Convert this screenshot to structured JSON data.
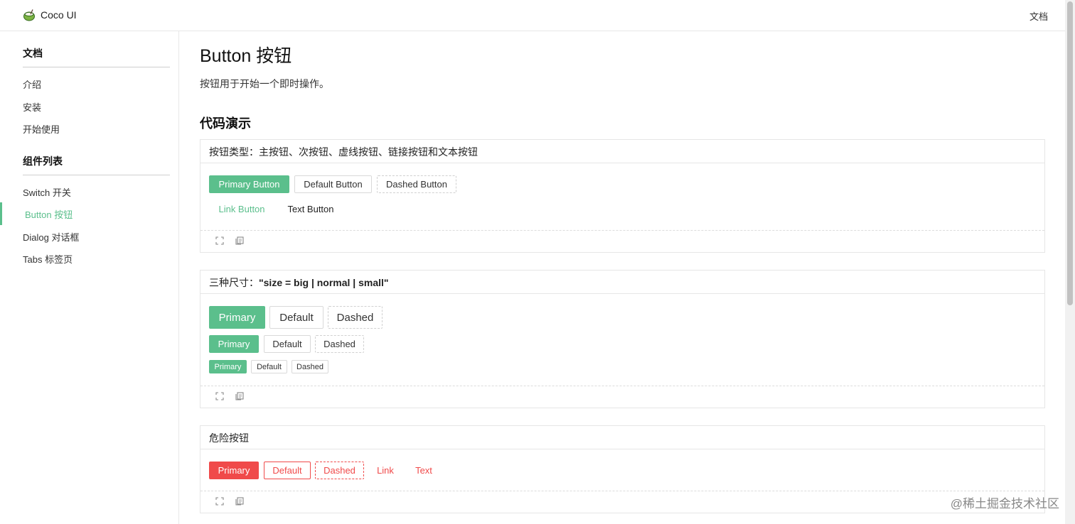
{
  "app": {
    "name": "Coco UI"
  },
  "nav": {
    "docs_link": "文档"
  },
  "sidebar": {
    "groups": [
      {
        "title": "文档",
        "items": [
          "介绍",
          "安装",
          "开始使用"
        ]
      },
      {
        "title": "组件列表",
        "items": [
          "Switch 开关",
          "Button 按钮",
          "Dialog 对话框",
          "Tabs 标签页"
        ]
      }
    ],
    "active_item": "Button 按钮"
  },
  "page": {
    "title": "Button 按钮",
    "description": "按钮用于开始一个即时操作。",
    "section_title": "代码演示"
  },
  "demos": [
    {
      "title": "按钮类型：主按钮、次按钮、虚线按钮、链接按钮和文本按钮",
      "buttons": [
        "Primary Button",
        "Default Button",
        "Dashed Button",
        "Link Button",
        "Text Button"
      ]
    },
    {
      "title_prefix": "三种尺寸：",
      "title_code": "\"size = big | normal | small\"",
      "rows": [
        {
          "size": "big",
          "buttons": [
            "Primary",
            "Default",
            "Dashed"
          ]
        },
        {
          "size": "normal",
          "buttons": [
            "Primary",
            "Default",
            "Dashed"
          ]
        },
        {
          "size": "small",
          "buttons": [
            "Primary",
            "Default",
            "Dashed"
          ]
        }
      ]
    },
    {
      "title": "危险按钮",
      "buttons": [
        "Primary",
        "Default",
        "Dashed",
        "Link",
        "Text"
      ]
    }
  ],
  "demo_footer_icons": [
    "expand-icon",
    "copy-icon"
  ],
  "colors": {
    "primary": "#5bbf8c",
    "danger": "#f04a4a",
    "border": "#d9d9d9"
  },
  "watermark": "@稀土掘金技术社区"
}
